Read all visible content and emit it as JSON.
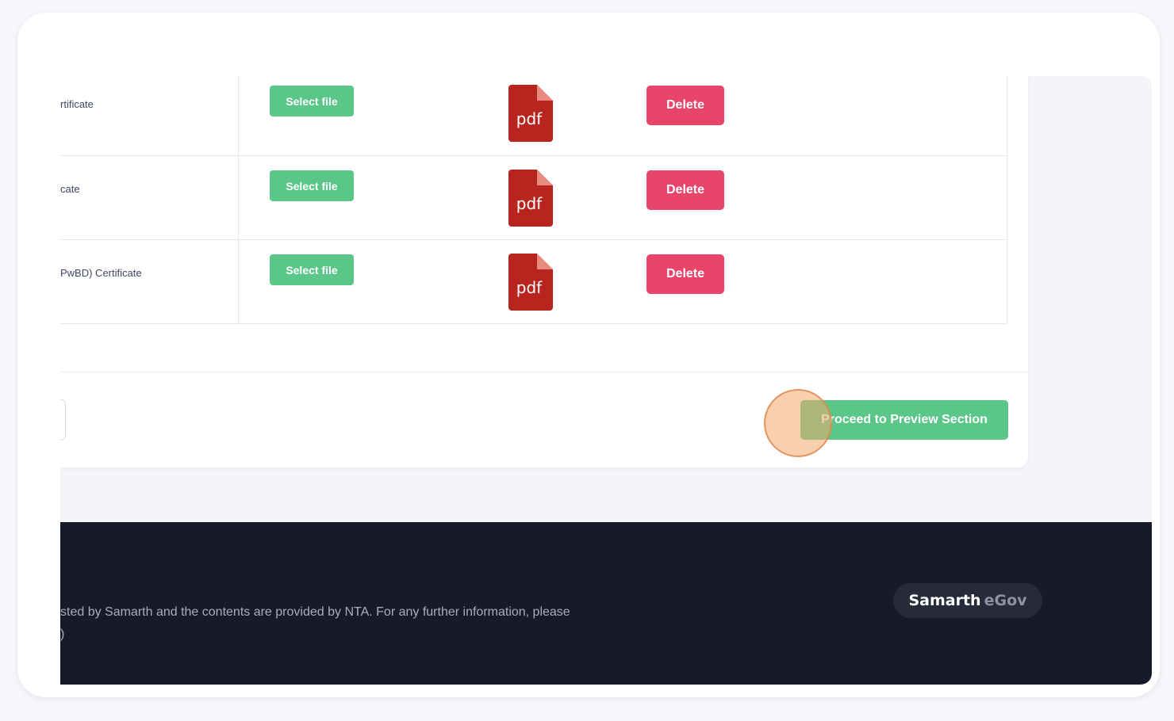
{
  "documents": [
    {
      "label": "rtificate",
      "select_label": "Select file",
      "file_type": "pdf",
      "delete_label": "Delete"
    },
    {
      "label": "cate",
      "select_label": "Select file",
      "file_type": "pdf",
      "delete_label": "Delete"
    },
    {
      "label": "PwBD) Certificate",
      "select_label": "Select file",
      "file_type": "pdf",
      "delete_label": "Delete"
    }
  ],
  "actions": {
    "proceed_label": "Proceed to Preview Section"
  },
  "footer": {
    "line1": "sted by Samarth and the contents are provided by NTA. For any further information, please",
    "line2": ")",
    "brand_primary": "Samarth",
    "brand_secondary": "eGov"
  },
  "colors": {
    "success": "#5ac688",
    "danger": "#e8456a",
    "pdf": "#b8251f",
    "footer_bg": "#171a2a"
  },
  "icons": {
    "file": "pdf-file-icon"
  }
}
